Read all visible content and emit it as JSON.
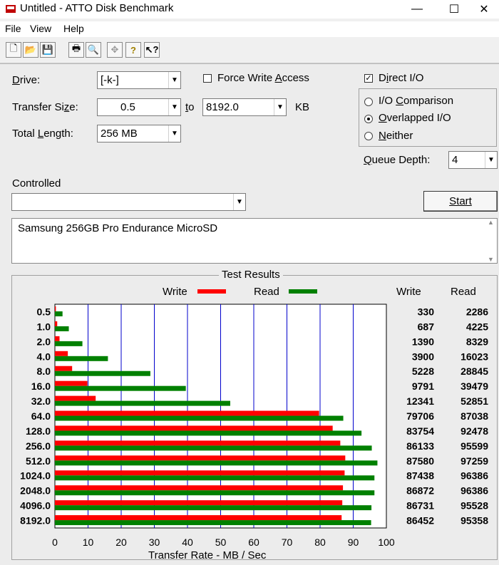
{
  "window": {
    "title": "Untitled - ATTO Disk Benchmark",
    "minimize": "—",
    "maximize": "☐",
    "close": "✕"
  },
  "menu": [
    "File",
    "View",
    "Help"
  ],
  "toolbar": {
    "icons": [
      "new-icon",
      "open-icon",
      "save-icon",
      "print-icon",
      "print-preview-icon",
      "move-icon",
      "help-icon",
      "context-help-icon"
    ]
  },
  "form": {
    "drive_label": "Drive:",
    "drive_value": "[-k-]",
    "force_write_label": "Force Write Access",
    "force_write_checked": false,
    "direct_io_label": "Direct I/O",
    "direct_io_checked": true,
    "transfer_size_label": "Transfer Size:",
    "transfer_from": "0.5",
    "to_label": "to",
    "transfer_to": "8192.0",
    "kb_label": "KB",
    "total_length_label": "Total Length:",
    "total_length_value": "256 MB",
    "io_modes": [
      {
        "label": "I/O Comparison",
        "selected": false
      },
      {
        "label": "Overlapped I/O",
        "selected": true
      },
      {
        "label": "Neither",
        "selected": false
      }
    ],
    "queue_depth_label": "Queue Depth:",
    "queue_depth_value": "4",
    "controlled_label": "Controlled",
    "controlled_value": "",
    "start_label": "Start",
    "description": "Samsung 256GB Pro Endurance MicroSD"
  },
  "results": {
    "title": "Test Results",
    "legend_write": "Write",
    "legend_read": "Read",
    "col_write": "Write",
    "col_read": "Read",
    "xlabel": "Transfer Rate - MB / Sec",
    "colors": {
      "write": "#ff0000",
      "read": "#008000",
      "grid": "#0000cc"
    }
  },
  "chart_data": {
    "type": "bar",
    "title": "Test Results",
    "xlabel": "Transfer Rate - MB / Sec",
    "xlim": [
      0,
      100
    ],
    "xticks": [
      "0",
      "10",
      "20",
      "30",
      "40",
      "50",
      "60",
      "70",
      "80",
      "90",
      "100"
    ],
    "categories": [
      "0.5",
      "1.0",
      "2.0",
      "4.0",
      "8.0",
      "16.0",
      "32.0",
      "64.0",
      "128.0",
      "256.0",
      "512.0",
      "1024.0",
      "2048.0",
      "4096.0",
      "8192.0"
    ],
    "series": [
      {
        "name": "Write",
        "color": "#ff0000",
        "values": [
          0.3,
          0.7,
          1.4,
          3.9,
          5.2,
          9.8,
          12.3,
          79.7,
          83.8,
          86.1,
          87.6,
          87.4,
          86.9,
          86.7,
          86.5
        ],
        "labels": [
          "330",
          "687",
          "1390",
          "3900",
          "5228",
          "9791",
          "12341",
          "79706",
          "83754",
          "86133",
          "87580",
          "87438",
          "86872",
          "86731",
          "86452"
        ]
      },
      {
        "name": "Read",
        "color": "#008000",
        "values": [
          2.3,
          4.2,
          8.3,
          16.0,
          28.8,
          39.5,
          52.9,
          87.0,
          92.5,
          95.6,
          97.3,
          96.4,
          96.4,
          95.5,
          95.4
        ],
        "labels": [
          "2286",
          "4225",
          "8329",
          "16023",
          "28845",
          "39479",
          "52851",
          "87038",
          "92478",
          "95599",
          "97259",
          "96386",
          "96386",
          "95528",
          "95358"
        ]
      }
    ]
  }
}
